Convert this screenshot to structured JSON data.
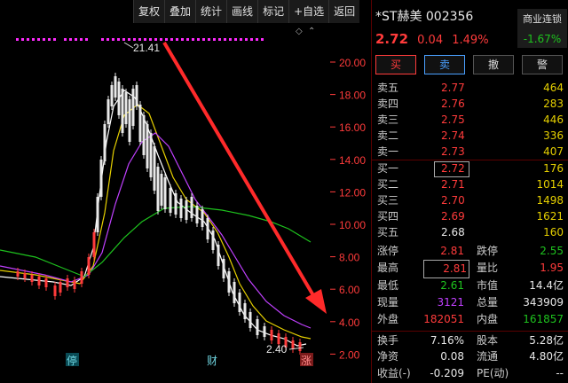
{
  "toolbar": [
    "复权",
    "叠加",
    "统计",
    "画线",
    "标记",
    "+自选",
    "返回"
  ],
  "chart": {
    "y_ticks": [
      "20.00",
      "18.00",
      "16.00",
      "14.00",
      "12.00",
      "10.00",
      "8.00",
      "6.00",
      "4.00",
      "2.00"
    ],
    "peak_label": "21.41",
    "low_label": "2.40",
    "markers": {
      "halt": "停",
      "earnings": "财",
      "limit": "涨"
    },
    "colors": {
      "candle_up": "#ff3b3b",
      "ma5": "#ffffff",
      "ma10": "#e6d000",
      "ma20": "#c040ff",
      "ma60": "#1ec31e",
      "arrow": "#ff2a2a",
      "dots": "#ff2aff"
    },
    "corner_icons": [
      "diamond-icon",
      "chevron-up-icon"
    ]
  },
  "panel": {
    "name": "*ST赫美 002356",
    "sector": "商业连锁",
    "sector_pct": "-1.67%",
    "price": "2.72",
    "change": "0.04",
    "change_pct": "1.49%",
    "buttons": [
      "买",
      "卖",
      "撤",
      "警"
    ],
    "asks": [
      {
        "label": "卖五",
        "price": "2.77",
        "vol": "464"
      },
      {
        "label": "卖四",
        "price": "2.76",
        "vol": "283"
      },
      {
        "label": "卖三",
        "price": "2.75",
        "vol": "446"
      },
      {
        "label": "卖二",
        "price": "2.74",
        "vol": "336"
      },
      {
        "label": "卖一",
        "price": "2.73",
        "vol": "407"
      }
    ],
    "bids": [
      {
        "label": "买一",
        "price": "2.72",
        "vol": "176"
      },
      {
        "label": "买二",
        "price": "2.71",
        "vol": "1014"
      },
      {
        "label": "买三",
        "price": "2.70",
        "vol": "1498"
      },
      {
        "label": "买四",
        "price": "2.69",
        "vol": "1621"
      },
      {
        "label": "买五",
        "price": "2.68",
        "vol": "160"
      }
    ],
    "stats": [
      {
        "l1": "涨停",
        "v1": "2.81",
        "c1": "red",
        "l2": "跌停",
        "v2": "2.55",
        "c2": "green"
      },
      {
        "l1": "最高",
        "v1": "2.81",
        "c1": "red",
        "l2": "量比",
        "v2": "1.95",
        "c2": "red"
      },
      {
        "l1": "最低",
        "v1": "2.61",
        "c1": "green",
        "l2": "市值",
        "v2": "14.4亿",
        "c2": "white"
      },
      {
        "l1": "现量",
        "v1": "3121",
        "c1": "purple",
        "l2": "总量",
        "v2": "343909",
        "c2": "white"
      },
      {
        "l1": "外盘",
        "v1": "182051",
        "c1": "red",
        "l2": "内盘",
        "v2": "161857",
        "c2": "green"
      },
      {
        "l1": "换手",
        "v1": "7.16%",
        "c1": "white",
        "l2": "股本",
        "v2": "5.28亿",
        "c2": "white"
      },
      {
        "l1": "净资",
        "v1": "0.08",
        "c1": "white",
        "l2": "流通",
        "v2": "4.80亿",
        "c2": "white"
      },
      {
        "l1": "收益(-)",
        "v1": "-0.209",
        "c1": "white",
        "l2": "PE(动)",
        "v2": "--",
        "c2": "white"
      }
    ]
  }
}
